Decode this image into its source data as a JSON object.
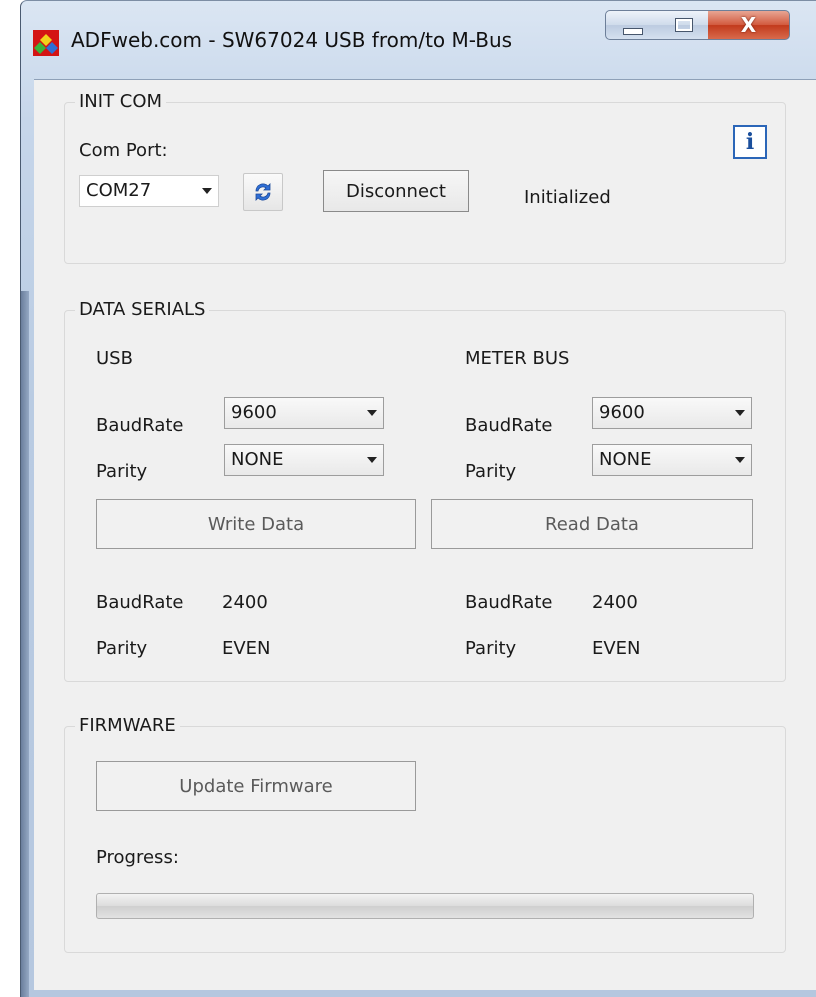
{
  "window": {
    "title": "ADFweb.com - SW67024 USB from/to M-Bus",
    "controls": {
      "minimize": "minimize",
      "maximize": "maximize",
      "close_glyph": "X"
    }
  },
  "init_com": {
    "legend": "INIT COM",
    "com_port_label": "Com Port:",
    "com_port_value": "COM27",
    "disconnect_label": "Disconnect",
    "status": "Initialized",
    "info_glyph": "i"
  },
  "data_serials": {
    "legend": "DATA SERIALS",
    "usb": {
      "heading": "USB",
      "baudrate_label": "BaudRate",
      "baudrate_value": "9600",
      "parity_label": "Parity",
      "parity_value": "NONE",
      "action_label": "Write Data",
      "current_baudrate_label": "BaudRate",
      "current_baudrate_value": "2400",
      "current_parity_label": "Parity",
      "current_parity_value": "EVEN"
    },
    "meter_bus": {
      "heading": "METER BUS",
      "baudrate_label": "BaudRate",
      "baudrate_value": "9600",
      "parity_label": "Parity",
      "parity_value": "NONE",
      "action_label": "Read Data",
      "current_baudrate_label": "BaudRate",
      "current_baudrate_value": "2400",
      "current_parity_label": "Parity",
      "current_parity_value": "EVEN"
    }
  },
  "firmware": {
    "legend": "FIRMWARE",
    "update_label": "Update Firmware",
    "progress_label": "Progress:",
    "progress_value": 0
  },
  "colors": {
    "close_button": "#c23a1c",
    "info_border": "#2b66b8",
    "window_glass": "#c6d6ea"
  },
  "icons": {
    "app": "adfweb-app-icon",
    "refresh": "refresh-icon",
    "info": "info-icon"
  }
}
